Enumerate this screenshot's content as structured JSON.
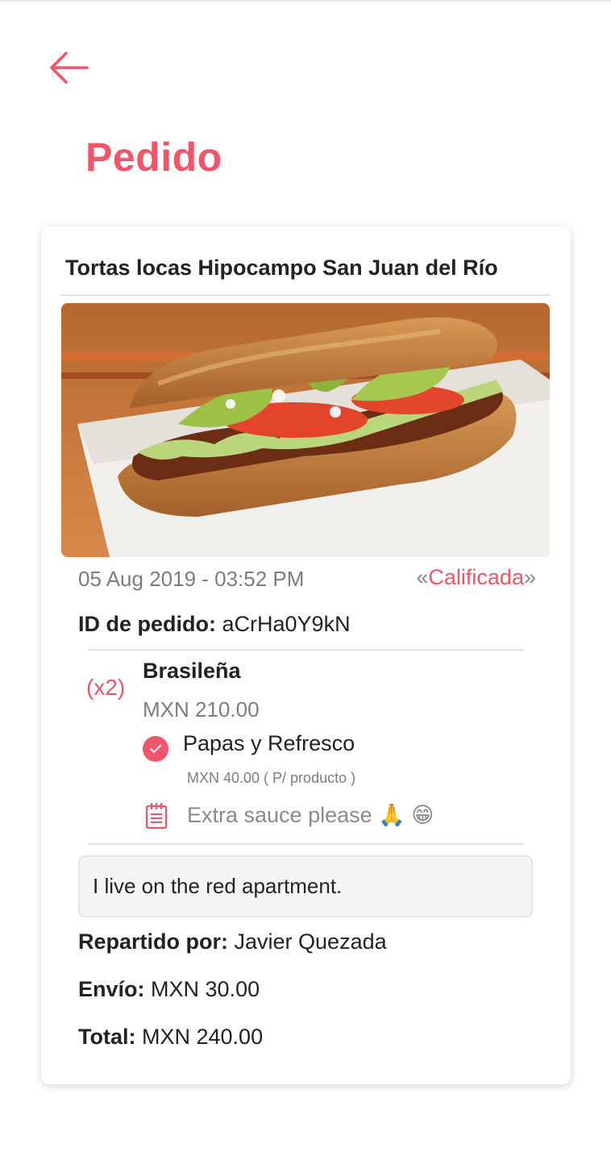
{
  "header": {
    "back_icon": "arrow-left-icon",
    "title": "Pedido",
    "accent_color": "#f0556a"
  },
  "order": {
    "restaurant": "Tortas locas Hipocampo San Juan del Río",
    "image": "torta-sandwich-photo",
    "date": "05 Aug 2019 - 03:52 PM",
    "status_open": "«",
    "status": "Calificada",
    "status_close": "»",
    "id_label": "ID de pedido:",
    "id_value": "aCrHa0Y9kN",
    "items": [
      {
        "qty": "(x2)",
        "name": "Brasileña",
        "price": "MXN 210.00",
        "extra": {
          "icon": "check-circle-icon",
          "name": "Papas y Refresco",
          "price": "MXN 40.00 ( P/ producto )"
        },
        "note": {
          "icon": "notepad-icon",
          "text": "Extra sauce please 🙏 😁"
        }
      }
    ],
    "instructions": "I live on the red apartment.",
    "delivered_by_label": "Repartido por:",
    "delivered_by": "Javier Quezada",
    "shipping_label": "Envío:",
    "shipping": "MXN 30.00",
    "total_label": "Total:",
    "total": "MXN 240.00"
  }
}
